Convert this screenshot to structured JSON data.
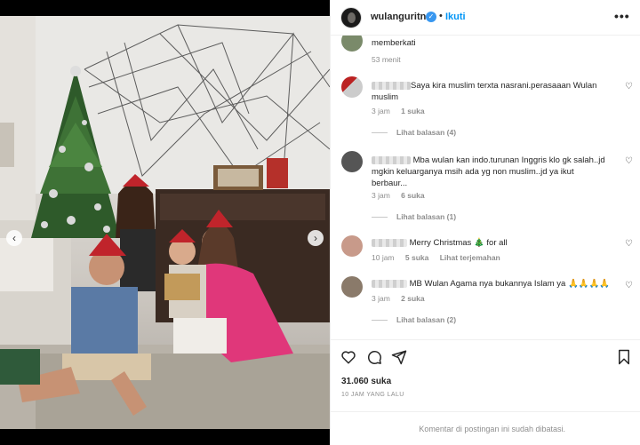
{
  "header": {
    "username": "wulanguritno",
    "separator": "•",
    "follow_label": "Ikuti",
    "more_icon": "more-horizontal-icon"
  },
  "carousel": {
    "prev_icon": "chevron-left-icon",
    "next_icon": "chevron-right-icon",
    "dot_count": 4,
    "active_dot": 2
  },
  "comments": [
    {
      "text": "memberkati",
      "meta": {
        "time": "53 menit"
      }
    },
    {
      "text": "Saya kira muslim terxta nasrani.perasaaan Wulan muslim",
      "meta": {
        "time": "3 jam",
        "likes": "1 suka"
      },
      "replies": "Lihat balasan (4)"
    },
    {
      "text": "Mba wulan kan indo.turunan Inggris klo gk salah..jd mgkin keluarganya msih ada yg non muslim..jd ya ikut berbaur...",
      "meta": {
        "time": "3 jam",
        "likes": "6 suka"
      },
      "replies": "Lihat balasan (1)"
    },
    {
      "text": "Merry Christmas 🎄 for all",
      "meta": {
        "time": "10 jam",
        "likes": "5 suka",
        "translate": "Lihat terjemahan"
      }
    },
    {
      "text": "MB Wulan Agama nya bukannya Islam ya 🙏🙏🙏🙏",
      "meta": {
        "time": "3 jam",
        "likes": "2 suka"
      },
      "replies": "Lihat balasan (2)"
    }
  ],
  "actions": {
    "like_icon": "heart-icon",
    "comment_icon": "comment-icon",
    "share_icon": "share-icon",
    "save_icon": "bookmark-icon"
  },
  "likes_count": "31.060 suka",
  "posted_time": "10 JAM YANG LALU",
  "footer_notice": "Komentar di postingan ini sudah dibatasi."
}
